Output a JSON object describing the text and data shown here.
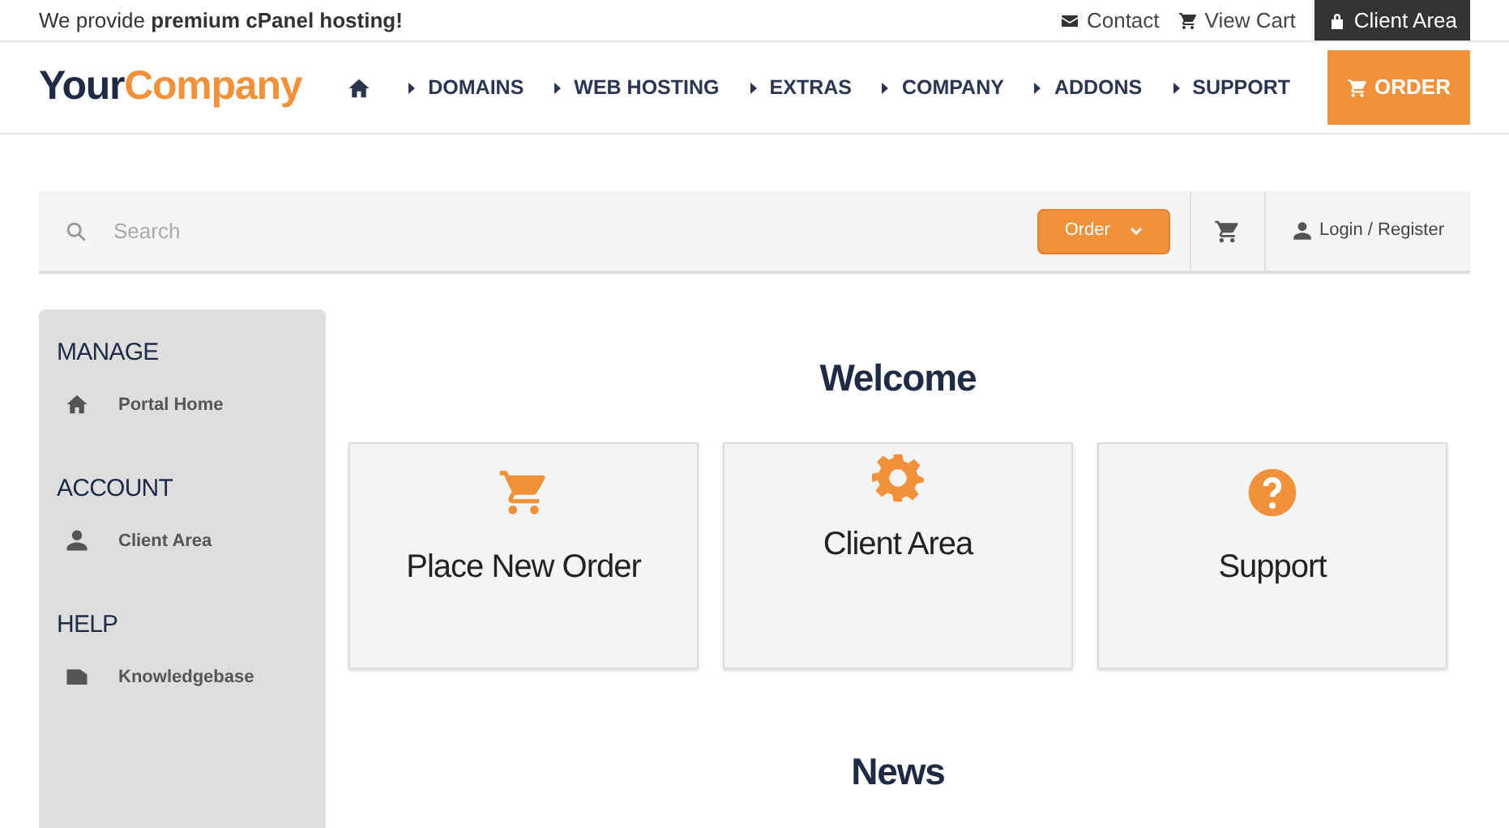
{
  "topbar": {
    "tagline": "We provide **premium cPanel hosting!**",
    "links": [
      {
        "label": "Contact",
        "kind": "envelope"
      },
      {
        "label": "View Cart",
        "kind": "cart"
      },
      {
        "label": "Client Area",
        "kind": "lock"
      }
    ]
  },
  "logo": {
    "first": "Your",
    "second": "Company"
  },
  "nav": {
    "items": [
      "DOMAINS",
      "WEB HOSTING",
      "EXTRAS",
      "COMPANY",
      "ADDONS",
      "SUPPORT"
    ],
    "order": "ORDER"
  },
  "searchbar": {
    "placeholder": "Search",
    "order_button": "Order",
    "login": "Login / Register"
  },
  "sidebar": [
    {
      "heading": "MANAGE",
      "items": [
        {
          "label": "Portal Home",
          "kind": "home"
        }
      ]
    },
    {
      "heading": "ACCOUNT",
      "items": [
        {
          "label": "Client Area",
          "kind": "user"
        }
      ]
    },
    {
      "heading": "HELP",
      "items": [
        {
          "label": "Knowledgebase",
          "kind": "folder"
        }
      ]
    }
  ],
  "main": {
    "welcome": "Welcome",
    "cards": [
      {
        "label": "Place New Order",
        "kind": "cart"
      },
      {
        "label": "Client Area",
        "kind": "gear"
      },
      {
        "label": "Support",
        "kind": "question"
      }
    ],
    "news": "News"
  }
}
